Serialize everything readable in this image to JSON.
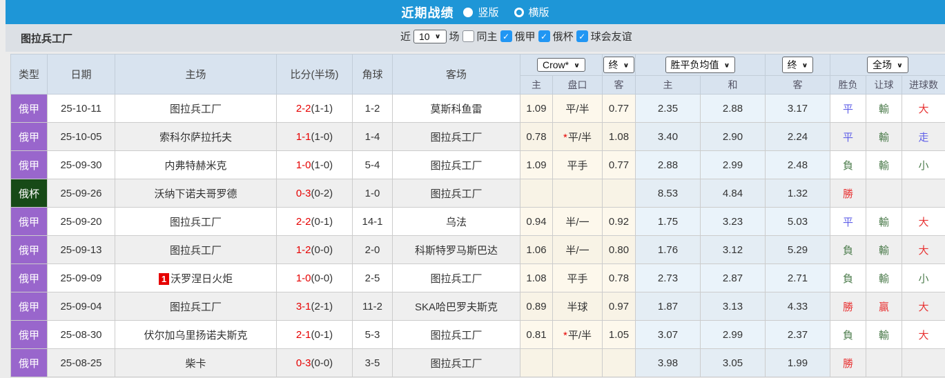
{
  "palette": {
    "topbar_blue": "#1e96d7",
    "filter_bg": "#dce0e5",
    "header_bg": "#d8e3ef",
    "stripe_gray": "#efefef",
    "crow_col_bg": "#fdf8ec",
    "avg_col_bg": "#eaf3fa",
    "league_purple": "#9966cc",
    "league_darkgreen": "#174a17",
    "focal_team_green": "#3aa33a",
    "score_red": "#e60000",
    "checkbox_blue": "#2196f3",
    "result_red": "#e83333",
    "result_green": "#4e7d4e",
    "result_blue": "#5f5fe8"
  },
  "icons": {
    "chevron_down": "∨",
    "check": "✓"
  },
  "topbar": {
    "title": "近期战绩",
    "radio_vertical_label": "竖版",
    "radio_horizontal_label": "横版",
    "selected": "竖版"
  },
  "filterbar": {
    "team": "图拉兵工厂",
    "recent_label": "近",
    "recent_value": "10",
    "games_label": "场",
    "same_home_label": "同主",
    "same_home_checked": false,
    "leagues": [
      {
        "label": "俄甲",
        "checked": true
      },
      {
        "label": "俄杯",
        "checked": true
      },
      {
        "label": "球会友谊",
        "checked": true
      }
    ]
  },
  "table": {
    "columns": {
      "type": "类型",
      "date": "日期",
      "home": "主场",
      "score": "比分(半场)",
      "corner": "角球",
      "away": "客场",
      "crow_select": "Crow*",
      "crow_final_select": "终",
      "avg_select": "胜平负均值",
      "avg_final_select": "终",
      "full_select": "全场",
      "sub_home": "主",
      "sub_handicap": "盘口",
      "sub_away": "客",
      "sub_avg_home": "主",
      "sub_avg_draw": "和",
      "sub_avg_away": "客",
      "sub_wdl": "胜负",
      "sub_handicap_result": "让球",
      "sub_goals": "进球数"
    },
    "rows": [
      {
        "league": "俄甲",
        "league_color": "purple",
        "date": "25-10-11",
        "home": "图拉兵工厂",
        "home_focal": true,
        "home_rank": "",
        "score": "2-2",
        "half": "(1-1)",
        "corner": "1-2",
        "away": "莫斯科鱼雷",
        "away_focal": false,
        "odds_home": "1.09",
        "star": "",
        "handicap": "平/半",
        "odds_away": "0.77",
        "avg_home": "2.35",
        "avg_draw": "2.88",
        "avg_away": "3.17",
        "wdl": "平",
        "wdl_c": "blue",
        "hres": "輸",
        "hres_c": "green",
        "goals": "大",
        "goals_c": "red"
      },
      {
        "league": "俄甲",
        "league_color": "purple",
        "date": "25-10-05",
        "home": "索科尔萨拉托夫",
        "home_focal": false,
        "home_rank": "",
        "score": "1-1",
        "half": "(1-0)",
        "corner": "1-4",
        "away": "图拉兵工厂",
        "away_focal": true,
        "odds_home": "0.78",
        "star": "*",
        "handicap": "平/半",
        "odds_away": "1.08",
        "avg_home": "3.40",
        "avg_draw": "2.90",
        "avg_away": "2.24",
        "wdl": "平",
        "wdl_c": "blue",
        "hres": "輸",
        "hres_c": "green",
        "goals": "走",
        "goals_c": "blue"
      },
      {
        "league": "俄甲",
        "league_color": "purple",
        "date": "25-09-30",
        "home": "内弗特赫米克",
        "home_focal": false,
        "home_rank": "",
        "score": "1-0",
        "half": "(1-0)",
        "corner": "5-4",
        "away": "图拉兵工厂",
        "away_focal": true,
        "odds_home": "1.09",
        "star": "",
        "handicap": "平手",
        "odds_away": "0.77",
        "avg_home": "2.88",
        "avg_draw": "2.99",
        "avg_away": "2.48",
        "wdl": "負",
        "wdl_c": "green",
        "hres": "輸",
        "hres_c": "green",
        "goals": "小",
        "goals_c": "green"
      },
      {
        "league": "俄杯",
        "league_color": "darkgreen",
        "date": "25-09-26",
        "home": "沃纳下诺夫哥罗德",
        "home_focal": false,
        "home_rank": "",
        "score": "0-3",
        "half": "(0-2)",
        "corner": "1-0",
        "away": "图拉兵工厂",
        "away_focal": true,
        "odds_home": "",
        "star": "",
        "handicap": "",
        "odds_away": "",
        "avg_home": "8.53",
        "avg_draw": "4.84",
        "avg_away": "1.32",
        "wdl": "勝",
        "wdl_c": "red",
        "hres": "",
        "hres_c": "",
        "goals": "",
        "goals_c": ""
      },
      {
        "league": "俄甲",
        "league_color": "purple",
        "date": "25-09-20",
        "home": "图拉兵工厂",
        "home_focal": true,
        "home_rank": "",
        "score": "2-2",
        "half": "(0-1)",
        "corner": "14-1",
        "away": "乌法",
        "away_focal": false,
        "odds_home": "0.94",
        "star": "",
        "handicap": "半/一",
        "odds_away": "0.92",
        "avg_home": "1.75",
        "avg_draw": "3.23",
        "avg_away": "5.03",
        "wdl": "平",
        "wdl_c": "blue",
        "hres": "輸",
        "hres_c": "green",
        "goals": "大",
        "goals_c": "red"
      },
      {
        "league": "俄甲",
        "league_color": "purple",
        "date": "25-09-13",
        "home": "图拉兵工厂",
        "home_focal": true,
        "home_rank": "",
        "score": "1-2",
        "half": "(0-0)",
        "corner": "2-0",
        "away": "科斯特罗马斯巴达",
        "away_focal": false,
        "odds_home": "1.06",
        "star": "",
        "handicap": "半/一",
        "odds_away": "0.80",
        "avg_home": "1.76",
        "avg_draw": "3.12",
        "avg_away": "5.29",
        "wdl": "負",
        "wdl_c": "green",
        "hres": "輸",
        "hres_c": "green",
        "goals": "大",
        "goals_c": "red"
      },
      {
        "league": "俄甲",
        "league_color": "purple",
        "date": "25-09-09",
        "home": "沃罗涅日火炬",
        "home_focal": false,
        "home_rank": "1",
        "score": "1-0",
        "half": "(0-0)",
        "corner": "2-5",
        "away": "图拉兵工厂",
        "away_focal": true,
        "odds_home": "1.08",
        "star": "",
        "handicap": "平手",
        "odds_away": "0.78",
        "avg_home": "2.73",
        "avg_draw": "2.87",
        "avg_away": "2.71",
        "wdl": "負",
        "wdl_c": "green",
        "hres": "輸",
        "hres_c": "green",
        "goals": "小",
        "goals_c": "green"
      },
      {
        "league": "俄甲",
        "league_color": "purple",
        "date": "25-09-04",
        "home": "图拉兵工厂",
        "home_focal": true,
        "home_rank": "",
        "score": "3-1",
        "half": "(2-1)",
        "corner": "11-2",
        "away": "SKA哈巴罗夫斯克",
        "away_focal": false,
        "odds_home": "0.89",
        "star": "",
        "handicap": "半球",
        "odds_away": "0.97",
        "avg_home": "1.87",
        "avg_draw": "3.13",
        "avg_away": "4.33",
        "wdl": "勝",
        "wdl_c": "red",
        "hres": "贏",
        "hres_c": "red",
        "goals": "大",
        "goals_c": "red"
      },
      {
        "league": "俄甲",
        "league_color": "purple",
        "date": "25-08-30",
        "home": "伏尔加乌里扬诺夫斯克",
        "home_focal": false,
        "home_rank": "",
        "score": "2-1",
        "half": "(0-1)",
        "corner": "5-3",
        "away": "图拉兵工厂",
        "away_focal": true,
        "odds_home": "0.81",
        "star": "*",
        "handicap": "平/半",
        "odds_away": "1.05",
        "avg_home": "3.07",
        "avg_draw": "2.99",
        "avg_away": "2.37",
        "wdl": "負",
        "wdl_c": "green",
        "hres": "輸",
        "hres_c": "green",
        "goals": "大",
        "goals_c": "red"
      },
      {
        "league": "俄甲",
        "league_color": "purple",
        "date": "25-08-25",
        "home": "柴卡",
        "home_focal": false,
        "home_rank": "",
        "score": "0-3",
        "half": "(0-0)",
        "corner": "3-5",
        "away": "图拉兵工厂",
        "away_focal": true,
        "odds_home": "",
        "star": "",
        "handicap": "",
        "odds_away": "",
        "avg_home": "3.98",
        "avg_draw": "3.05",
        "avg_away": "1.99",
        "wdl": "勝",
        "wdl_c": "red",
        "hres": "",
        "hres_c": "",
        "goals": "",
        "goals_c": ""
      }
    ]
  }
}
